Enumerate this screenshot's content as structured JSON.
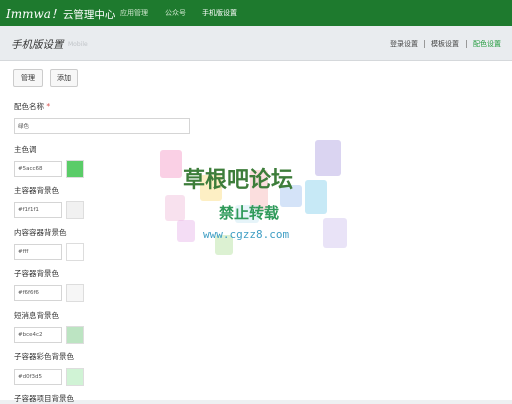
{
  "topbar": {
    "brand": "Immwa！",
    "brand_sub": "云管理中心",
    "nav": [
      "应用管理",
      "公众号",
      "手机版设置"
    ]
  },
  "page": {
    "title": "手机版设置",
    "subtitle": "Mobile",
    "tabs": [
      "登录设置",
      "模板设置",
      "配色设置"
    ]
  },
  "actions": {
    "manage": "管理",
    "add": "添加"
  },
  "form": {
    "name_label": "配色名称",
    "required_mark": "*",
    "name_value": "绿色",
    "fields": [
      {
        "label": "主色调",
        "value": "#5acc68",
        "color": "#5acc68"
      },
      {
        "label": "主容器背景色",
        "value": "#f1f1f1",
        "color": "#f1f1f1"
      },
      {
        "label": "内容容器背景色",
        "value": "#fff",
        "color": "#ffffff"
      },
      {
        "label": "子容器背景色",
        "value": "#f6f6f6",
        "color": "#f6f6f6"
      },
      {
        "label": "短消息背景色",
        "value": "#bce4c2",
        "color": "#bce4c2"
      },
      {
        "label": "子容器彩色背景色",
        "value": "#d0f3d5",
        "color": "#d0f3d5"
      },
      {
        "label": "子容器项目背景色"
      }
    ]
  },
  "watermark": {
    "line1": "草根吧论坛",
    "line2": "禁止转载",
    "line3": "www.cgzz8.com"
  }
}
